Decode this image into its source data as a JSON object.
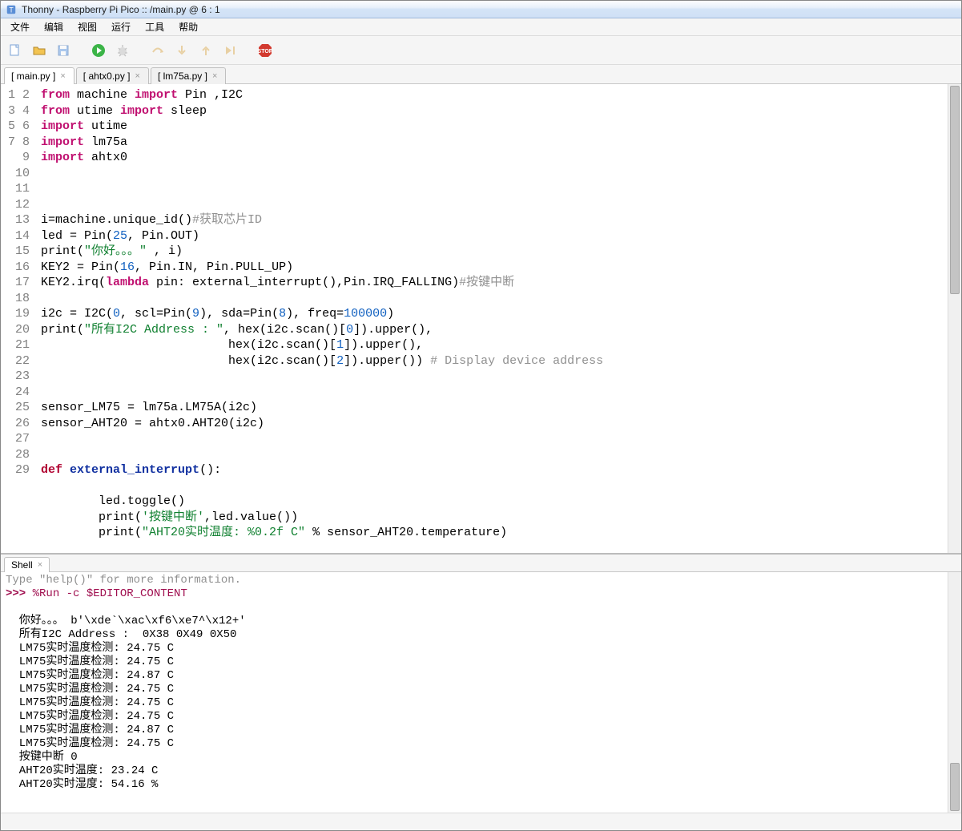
{
  "window": {
    "title": "Thonny  -  Raspberry Pi Pico :: /main.py  @  6 : 1"
  },
  "menu": {
    "file": "文件",
    "edit": "编辑",
    "view": "视图",
    "run": "运行",
    "tools": "工具",
    "help": "帮助"
  },
  "toolbar": {
    "new": "new",
    "open": "open",
    "save": "save",
    "run": "run",
    "debug": "debug",
    "stepover": "stepover",
    "stepinto": "stepinto",
    "stepout": "stepout",
    "resume": "resume",
    "stop": "stop"
  },
  "tabs": [
    {
      "label": "[ main.py ]",
      "active": true
    },
    {
      "label": "[ ahtx0.py ]",
      "active": false
    },
    {
      "label": "[ lm75a.py ]",
      "active": false
    }
  ],
  "editor": {
    "line_start": 1,
    "line_end": 29
  },
  "code_lines": [
    {
      "n": 1,
      "html": "<span class='kw-imp'>from</span> machine <span class='kw-imp'>import</span> Pin ,I2C"
    },
    {
      "n": 2,
      "html": "<span class='kw-imp'>from</span> utime <span class='kw-imp'>import</span> sleep"
    },
    {
      "n": 3,
      "html": "<span class='kw-imp'>import</span> utime"
    },
    {
      "n": 4,
      "html": "<span class='kw-imp'>import</span> lm75a"
    },
    {
      "n": 5,
      "html": "<span class='kw-imp'>import</span> ahtx0"
    },
    {
      "n": 6,
      "html": ""
    },
    {
      "n": 7,
      "html": ""
    },
    {
      "n": 8,
      "html": ""
    },
    {
      "n": 9,
      "html": "i=machine.unique_id()<span class='cmt'>#获取芯片ID</span>"
    },
    {
      "n": 10,
      "html": "led = Pin(<span class='num'>25</span>, Pin.OUT)"
    },
    {
      "n": 11,
      "html": "print(<span class='str'>\"你好。。。\"</span> , i)"
    },
    {
      "n": 12,
      "html": "KEY2 = Pin(<span class='num'>16</span>, Pin.IN, Pin.PULL_UP)"
    },
    {
      "n": 13,
      "html": "KEY2.irq(<span class='kw-imp'>lambda</span> pin: external_interrupt(),Pin.IRQ_FALLING)<span class='cmt'>#按键中断</span>"
    },
    {
      "n": 14,
      "html": ""
    },
    {
      "n": 15,
      "html": "i2c = I2C(<span class='num'>0</span>, scl=Pin(<span class='num'>9</span>), sda=Pin(<span class='num'>8</span>), freq=<span class='num'>100000</span>)"
    },
    {
      "n": 16,
      "html": "print(<span class='str'>\"所有I2C Address : \"</span>, hex(i2c.scan()[<span class='num'>0</span>]).upper(),"
    },
    {
      "n": 17,
      "html": "                          hex(i2c.scan()[<span class='num'>1</span>]).upper(),"
    },
    {
      "n": 18,
      "html": "                          hex(i2c.scan()[<span class='num'>2</span>]).upper()) <span class='cmt'># Display device address</span>"
    },
    {
      "n": 19,
      "html": ""
    },
    {
      "n": 20,
      "html": ""
    },
    {
      "n": 21,
      "html": "sensor_LM75 = lm75a.LM75A(i2c)"
    },
    {
      "n": 22,
      "html": "sensor_AHT20 = ahtx0.AHT20(i2c)"
    },
    {
      "n": 23,
      "html": ""
    },
    {
      "n": 24,
      "html": ""
    },
    {
      "n": 25,
      "html": "<span class='kw-def'>def</span> <span class='id-def'>external_interrupt</span>():"
    },
    {
      "n": 26,
      "html": ""
    },
    {
      "n": 27,
      "html": "        led.toggle()"
    },
    {
      "n": 28,
      "html": "        print(<span class='str'>'按键中断'</span>,led.value())"
    },
    {
      "n": 29,
      "html": "        print(<span class='str'>\"AHT20实时温度: %0.2f C\"</span> % sensor_AHT20.temperature)"
    }
  ],
  "shell": {
    "tab_label": "Shell",
    "help_line": "Type \"help()\" for more information.",
    "prompt": ">>> ",
    "command": "%Run -c $EDITOR_CONTENT",
    "output": [
      "  你好。。。 b'\\xde`\\xac\\xf6\\xe7^\\x12+'",
      "  所有I2C Address :  0X38 0X49 0X50",
      "  LM75实时温度检测: 24.75 C",
      "  LM75实时温度检测: 24.75 C",
      "  LM75实时温度检测: 24.87 C",
      "  LM75实时温度检测: 24.75 C",
      "  LM75实时温度检测: 24.75 C",
      "  LM75实时温度检测: 24.75 C",
      "  LM75实时温度检测: 24.87 C",
      "  LM75实时温度检测: 24.75 C",
      "  按键中断 0",
      "  AHT20实时温度: 23.24 C",
      "  AHT20实时湿度: 54.16 %"
    ]
  }
}
